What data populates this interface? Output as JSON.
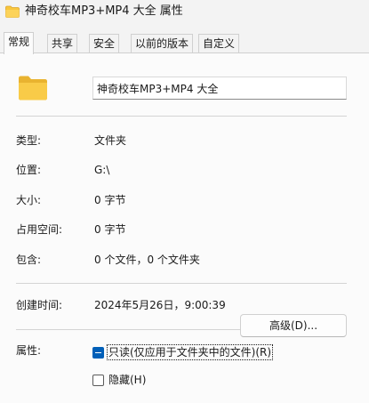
{
  "window": {
    "title": "神奇校车MP3+MP4 大全 属性",
    "icon": "folder-icon"
  },
  "tabs": [
    {
      "label": "常规",
      "active": true
    },
    {
      "label": "共享",
      "active": false
    },
    {
      "label": "安全",
      "active": false
    },
    {
      "label": "以前的版本",
      "active": false
    },
    {
      "label": "自定义",
      "active": false
    }
  ],
  "general": {
    "folder_icon": "folder-icon",
    "name_value": "神奇校车MP3+MP4 大全",
    "type_label": "类型:",
    "type_value": "文件夹",
    "location_label": "位置:",
    "location_value": "G:\\",
    "size_label": "大小:",
    "size_value": "0 字节",
    "size_on_disk_label": "占用空间:",
    "size_on_disk_value": "0 字节",
    "contains_label": "包含:",
    "contains_value": "0 个文件，0 个文件夹",
    "created_label": "创建时间:",
    "created_value": "2024年5月26日，9:00:39",
    "attributes_label": "属性:",
    "readonly_label": "只读(仅应用于文件夹中的文件)(R)",
    "readonly_state": "indeterminate",
    "hidden_label": "隐藏(H)",
    "hidden_state": "unchecked",
    "advanced_button": "高级(D)..."
  },
  "colors": {
    "window_bg": "#f3f3f3",
    "panel_bg": "#fbfbfb",
    "folder": "#f8c63d",
    "accent": "#005fb8"
  }
}
